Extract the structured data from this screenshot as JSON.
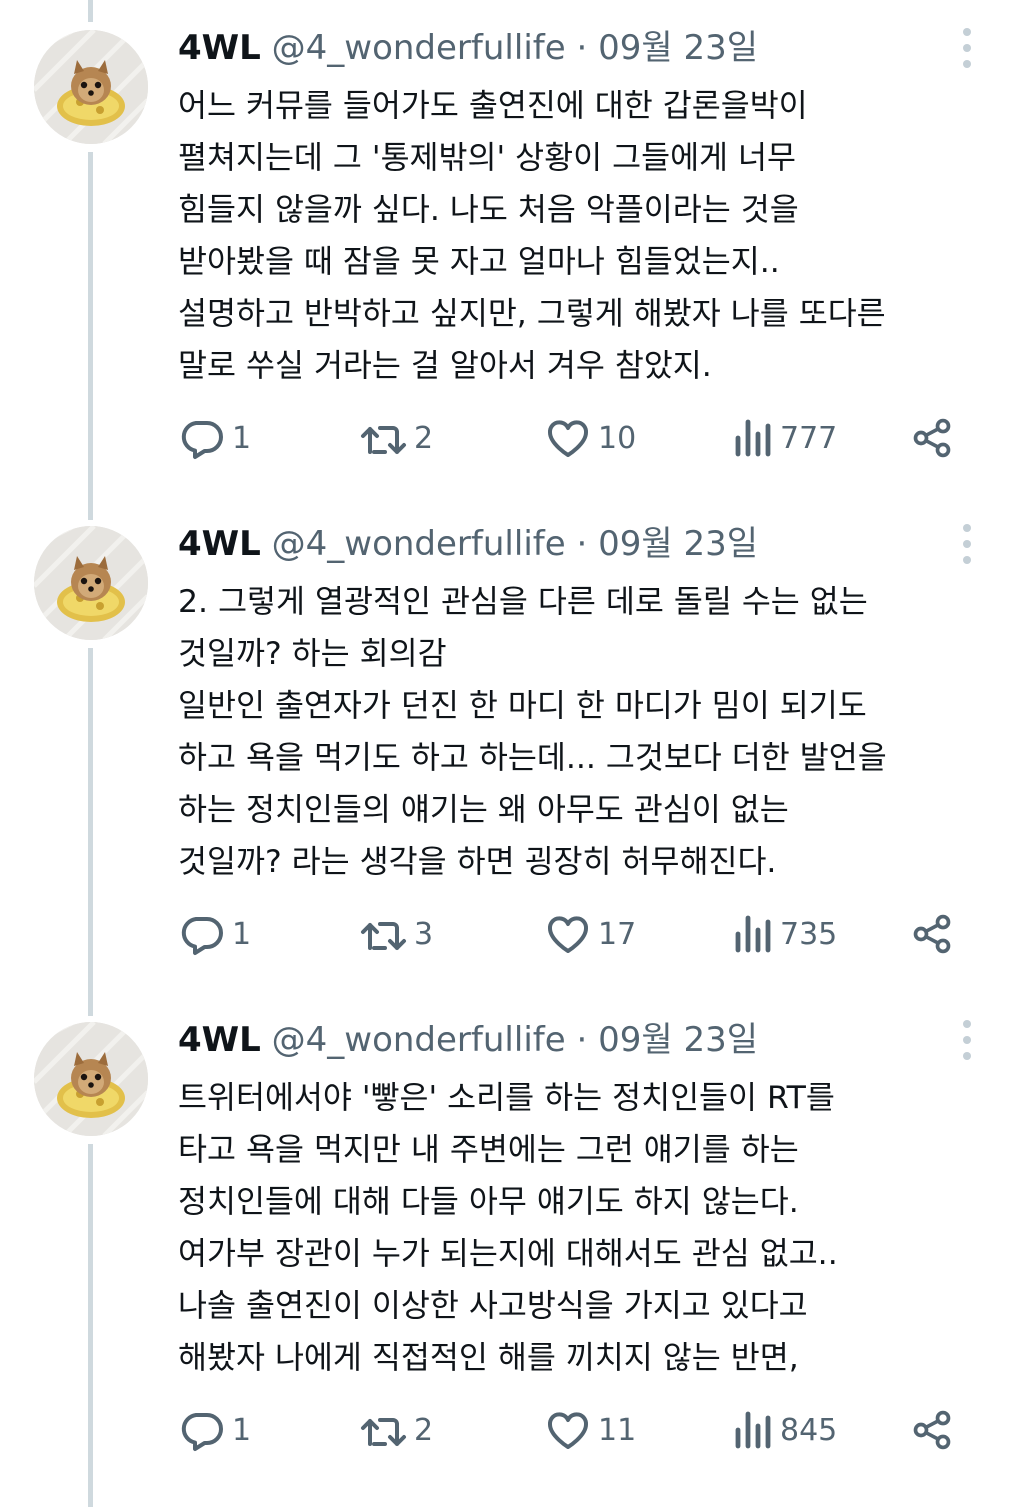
{
  "tweets": [
    {
      "name": "4WL",
      "handle": "@4_wonderfullife",
      "separator": "·",
      "date": "09월 23일",
      "lines": [
        "어느 커뮤를 들어가도 출연진에 대한 갑론을박이",
        "펼쳐지는데 그 '통제밖의' 상황이 그들에게 너무",
        "힘들지 않을까 싶다. 나도 처음 악플이라는 것을",
        "받아봤을 때 잠을 못 자고 얼마나 힘들었는지..",
        "설명하고 반박하고 싶지만, 그렇게 해봤자 나를 또다른",
        "말로 쑤실 거라는 걸 알아서 겨우 참았지."
      ],
      "replies": "1",
      "retweets": "2",
      "likes": "10",
      "views": "777"
    },
    {
      "name": "4WL",
      "handle": "@4_wonderfullife",
      "separator": "·",
      "date": "09월 23일",
      "lines": [
        "2. 그렇게 열광적인 관심을 다른 데로 돌릴 수는 없는",
        "것일까? 하는 회의감",
        "일반인 출연자가 던진 한 마디 한 마디가 밈이 되기도",
        "하고 욕을 먹기도 하고 하는데... 그것보다 더한 발언을",
        "하는 정치인들의 얘기는 왜 아무도 관심이 없는",
        "것일까? 라는 생각을 하면 굉장히 허무해진다."
      ],
      "replies": "1",
      "retweets": "3",
      "likes": "17",
      "views": "735"
    },
    {
      "name": "4WL",
      "handle": "@4_wonderfullife",
      "separator": "·",
      "date": "09월 23일",
      "lines": [
        "트위터에서야 '빻은' 소리를 하는 정치인들이 RT를",
        "타고 욕을 먹지만 내 주변에는 그런 얘기를 하는",
        "정치인들에 대해 다들 아무 얘기도 하지 않는다.",
        "여가부 장관이 누가 되는지에 대해서도 관심 없고..",
        "나솔 출연진이 이상한 사고방식을 가지고 있다고",
        "해봤자 나에게 직접적인 해를 끼치지 않는 반면,"
      ],
      "replies": "1",
      "retweets": "2",
      "likes": "11",
      "views": "845"
    }
  ],
  "icons": {
    "reply": "reply-icon",
    "retweet": "retweet-icon",
    "like": "heart-icon",
    "views": "views-icon",
    "share": "share-icon",
    "more": "more-options-icon",
    "avatar": "pomeranian-avatar"
  },
  "colors": {
    "text": "#0f1419",
    "secondary": "#536471",
    "thread_line": "#cfd9de"
  }
}
